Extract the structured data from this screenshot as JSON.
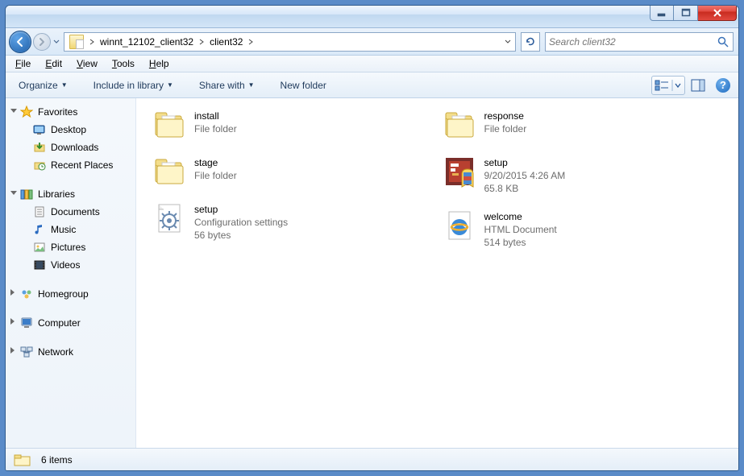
{
  "titlebar": {
    "title": ""
  },
  "breadcrumb": {
    "items": [
      "winnt_12102_client32",
      "client32"
    ]
  },
  "search": {
    "placeholder": "Search client32"
  },
  "menubar": {
    "items": [
      "File",
      "Edit",
      "View",
      "Tools",
      "Help"
    ]
  },
  "toolbar": {
    "organize": "Organize",
    "include": "Include in library",
    "share": "Share with",
    "newfolder": "New folder"
  },
  "nav": {
    "favorites": {
      "label": "Favorites",
      "items": [
        "Desktop",
        "Downloads",
        "Recent Places"
      ]
    },
    "libraries": {
      "label": "Libraries",
      "items": [
        "Documents",
        "Music",
        "Pictures",
        "Videos"
      ]
    },
    "homegroup": {
      "label": "Homegroup"
    },
    "computer": {
      "label": "Computer"
    },
    "network": {
      "label": "Network"
    }
  },
  "files": [
    {
      "name": "install",
      "meta1": "File folder",
      "meta2": "",
      "icon": "folder"
    },
    {
      "name": "stage",
      "meta1": "File folder",
      "meta2": "",
      "icon": "folder"
    },
    {
      "name": "setup",
      "meta1": "Configuration settings",
      "meta2": "56 bytes",
      "icon": "config"
    },
    {
      "name": "response",
      "meta1": "File folder",
      "meta2": "",
      "icon": "folder"
    },
    {
      "name": "setup",
      "meta1": "9/20/2015 4:26 AM",
      "meta2": "65.8 KB",
      "icon": "setupexe"
    },
    {
      "name": "welcome",
      "meta1": "HTML Document",
      "meta2": "514 bytes",
      "icon": "ie"
    }
  ],
  "status": {
    "count": "6 items"
  }
}
